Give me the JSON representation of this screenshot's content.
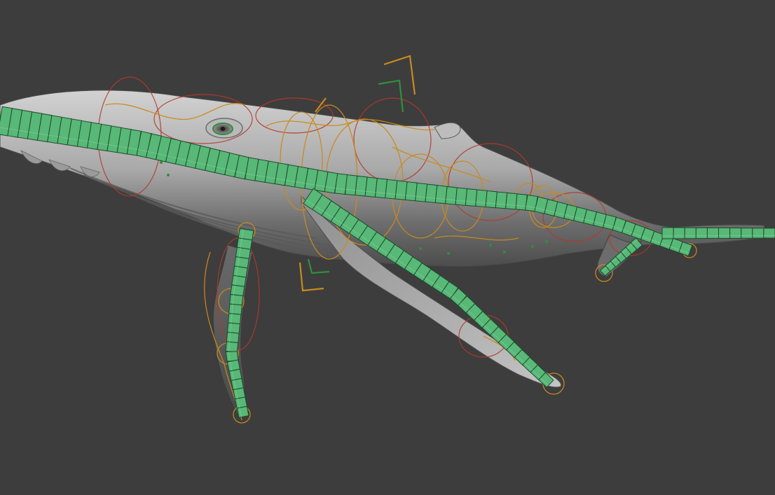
{
  "viewport": {
    "background_color": "#3d3d3d",
    "mode": "3d-viewport",
    "subject": "rigged-humpback-whale"
  },
  "colors": {
    "mesh_light": "#c9c9c9",
    "mesh_mid": "#9c9c9c",
    "mesh_dark": "#5e5e5e",
    "bone_fill": "#58b877",
    "bone_edge": "#1f4a2d",
    "control_orange": "#c98a1e",
    "control_red": "#b3392b",
    "control_green": "#2f8f3a"
  },
  "bone_chains": [
    "spine",
    "left-pectoral-fin",
    "right-pectoral-fin",
    "tail-fluke"
  ],
  "controls": [
    "orange-curve-controls",
    "red-circle-controls",
    "green-bracket-gizmo",
    "orange-bracket-gizmo"
  ]
}
